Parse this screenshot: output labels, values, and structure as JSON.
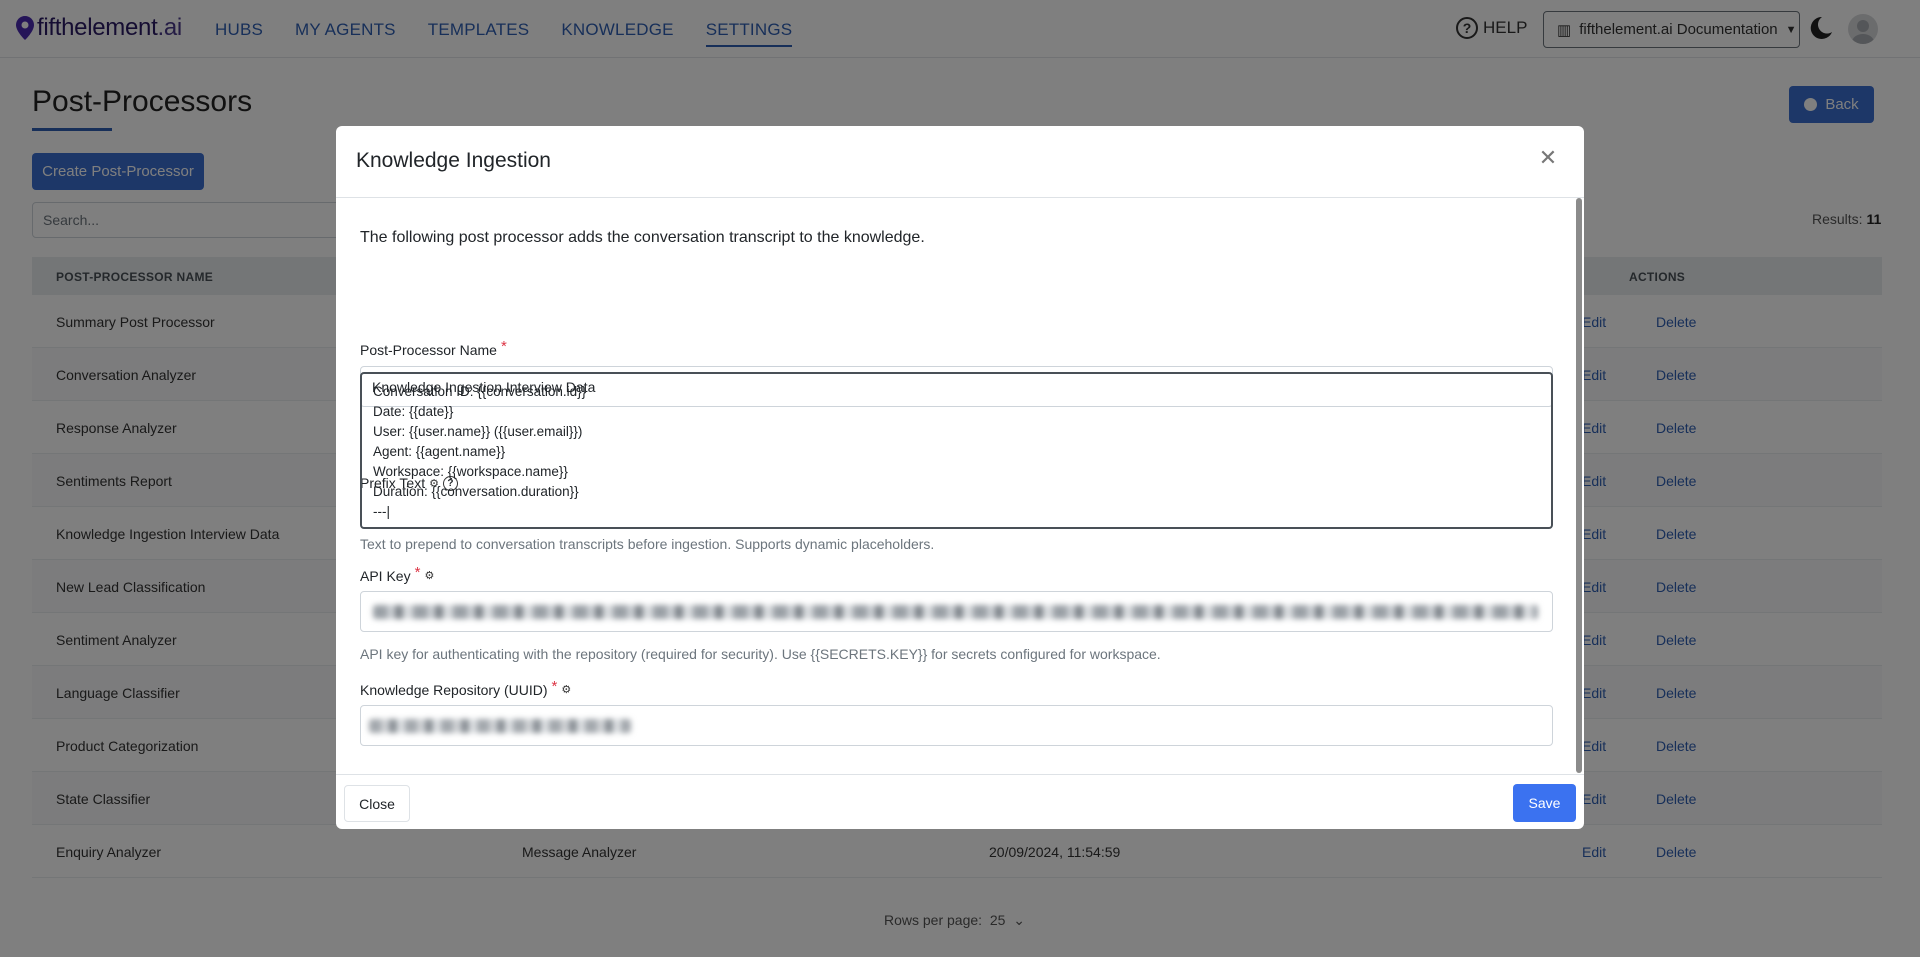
{
  "nav": {
    "brand_name": "fifthelement",
    "brand_suffix": ".ai",
    "links": [
      "HUBS",
      "MY AGENTS",
      "TEMPLATES",
      "KNOWLEDGE",
      "SETTINGS"
    ],
    "active": "SETTINGS",
    "help": "HELP",
    "workspace": "fifthelement.ai Documentation"
  },
  "page": {
    "title": "Post-Processors",
    "back": "Back",
    "create": "Create Post-Processor",
    "search_placeholder": "Search...",
    "results_label": "Results:",
    "results_count": "11",
    "rows_per_page_label": "Rows per page:",
    "rows_per_page": "25"
  },
  "table": {
    "headers": {
      "name": "POST-PROCESSOR NAME",
      "actions": "ACTIONS"
    },
    "rows": [
      {
        "name": "Summary Post Processor"
      },
      {
        "name": "Conversation Analyzer"
      },
      {
        "name": "Response Analyzer"
      },
      {
        "name": "Sentiments Report"
      },
      {
        "name": "Knowledge Ingestion Interview Data"
      },
      {
        "name": "New Lead Classification"
      },
      {
        "name": "Sentiment Analyzer"
      },
      {
        "name": "Language Classifier"
      },
      {
        "name": "Product Categorization"
      },
      {
        "name": "State Classifier"
      },
      {
        "name": "Enquiry Analyzer",
        "type": "Message Analyzer",
        "date": "20/09/2024, 11:54:59"
      }
    ],
    "edit_label": "Edit",
    "delete_label": "Delete"
  },
  "modal": {
    "title": "Knowledge Ingestion",
    "intro": "The following post processor adds the conversation transcript to the knowledge.",
    "name_label": "Post-Processor Name",
    "name_value": "Knowledge Ingestion Interview Data",
    "prefix_label": "Prefix Text",
    "prefix_value": "Conversation ID: {{conversation.id}}\nDate: {{date}}\nUser: {{user.name}} ({{user.email}})\nAgent: {{agent.name}}\nWorkspace: {{workspace.name}}\nDuration: {{conversation.duration}}\n---|",
    "prefix_help": "Text to prepend to conversation transcripts before ingestion. Supports dynamic placeholders.",
    "api_label": "API Key",
    "api_help": "API key for authenticating with the repository (required for security). Use {{SECRETS.KEY}} for secrets configured for workspace.",
    "repo_label": "Knowledge Repository (UUID)",
    "close": "Close",
    "save": "Save"
  },
  "colors": {
    "accent": "#3b6fd0",
    "save": "#3b72f0",
    "required": "#dc3545"
  }
}
